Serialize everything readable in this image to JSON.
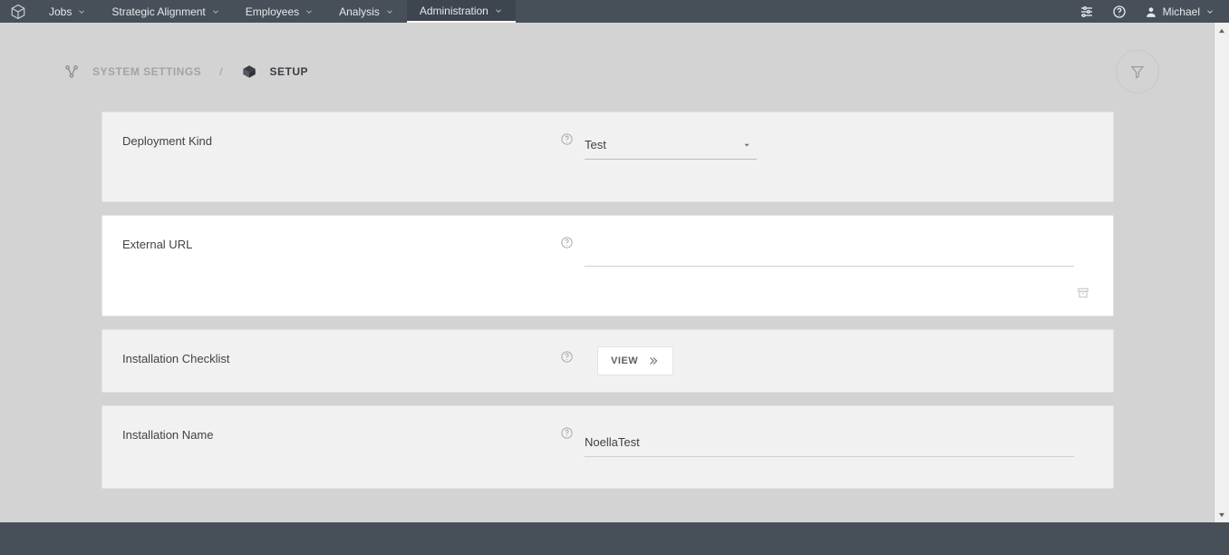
{
  "nav": {
    "items": [
      {
        "label": "Jobs"
      },
      {
        "label": "Strategic Alignment"
      },
      {
        "label": "Employees"
      },
      {
        "label": "Analysis"
      },
      {
        "label": "Administration"
      }
    ],
    "user": "Michael"
  },
  "breadcrumb": {
    "root": "SYSTEM SETTINGS",
    "sep": "/",
    "current": "SETUP"
  },
  "cards": {
    "deployment": {
      "label": "Deployment Kind",
      "value": "Test"
    },
    "external_url": {
      "label": "External URL",
      "value": ""
    },
    "checklist": {
      "label": "Installation Checklist",
      "button": "VIEW"
    },
    "install_name": {
      "label": "Installation Name",
      "value": "NoellaTest"
    }
  }
}
